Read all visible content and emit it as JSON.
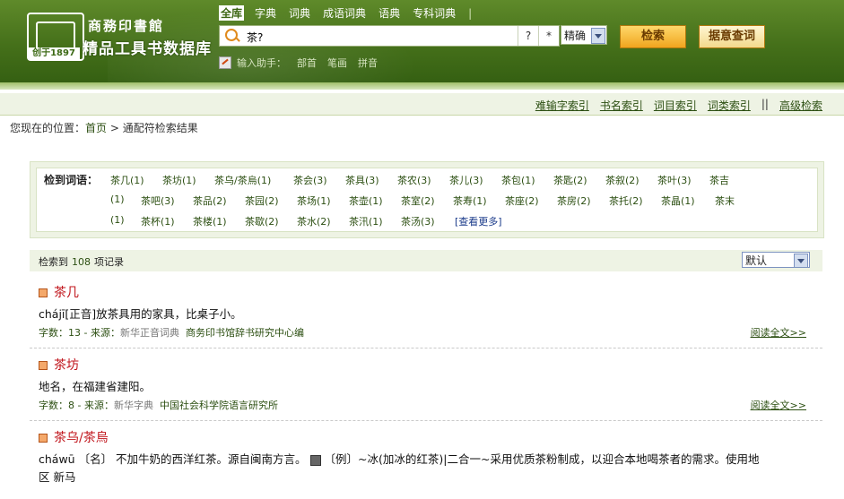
{
  "header": {
    "logo_est": "创于1897",
    "brand_top": "商務印書館",
    "brand_main": "精品工具书数据库",
    "dict_tabs": [
      "全库",
      "字典",
      "词典",
      "成语词典",
      "语典",
      "专科词典"
    ],
    "active_tab": 0,
    "search": {
      "value": "茶?",
      "wildcard_q": "?",
      "wildcard_star": "*"
    },
    "mode_select": "精确",
    "search_button": "检索",
    "any_query_button": "据意查词",
    "helper_label": "输入助手：",
    "helper_links": [
      "部首",
      "笔画",
      "拼音"
    ]
  },
  "index_bar": {
    "links": [
      "难输字索引",
      "书名索引",
      "词目索引",
      "词类索引",
      "高级检索"
    ],
    "separator": "||"
  },
  "breadcrumb": {
    "prefix": "您现在的位置：",
    "home": "首页",
    "sep": ">",
    "current": "通配符检索结果"
  },
  "words": {
    "label": "检到词语：",
    "items": [
      "茶几(1)",
      "茶坊(1)",
      "茶乌/茶烏(1)",
      "茶会(3)",
      "茶具(3)",
      "茶农(3)",
      "茶儿(3)",
      "茶包(1)",
      "茶匙(2)",
      "茶叙(2)",
      "茶叶(3)",
      "茶吉",
      "(1)",
      "茶吧(3)",
      "茶品(2)",
      "茶园(2)",
      "茶场(1)",
      "茶壶(1)",
      "茶室(2)",
      "茶寿(1)",
      "茶座(2)",
      "茶房(2)",
      "茶托(2)",
      "茶晶(1)",
      "茶末",
      "(1)",
      "茶杯(1)",
      "茶楼(1)",
      "茶歇(2)",
      "茶水(2)",
      "茶汛(1)",
      "茶汤(3)"
    ],
    "more": "[查看更多]"
  },
  "results": {
    "count_prefix": "检索到",
    "count": "108",
    "count_suffix": "项记录",
    "sort": "默认"
  },
  "entries": [
    {
      "head": "茶几",
      "def": "chájī[正音]放茶具用的家具，比桌子小。",
      "meta_count": "字数：13 -",
      "meta_source_label": "来源：",
      "meta_source": "新华正音词典",
      "meta_publisher": "商务印书馆辞书研究中心编",
      "read_more": "阅读全文>>"
    },
    {
      "head": "茶坊",
      "def": "地名，在福建省建阳。",
      "meta_count": "字数：8 -",
      "meta_source_label": "来源：",
      "meta_source": "新华字典",
      "meta_publisher": "中国社会科学院语言研究所",
      "read_more": "阅读全文>>"
    },
    {
      "head": "茶乌/茶烏",
      "def_part1": "cháwū 〔名〕 不加牛奶的西洋红茶。源自闽南方言。",
      "def_part2": "〔例〕~冰(加冰的红茶)|二合一~采用优质茶粉制成，以迎合本地喝茶者的需求。使用地",
      "def_line2": "区 新马"
    }
  ]
}
